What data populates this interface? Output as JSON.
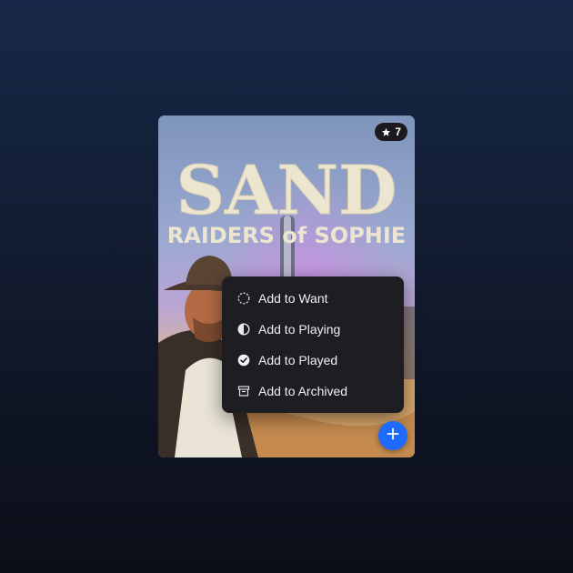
{
  "card": {
    "rating": "7",
    "cover_title": "SAND",
    "cover_subtitle": "RAIDERS of SOPHIE",
    "rating_icon": "star-icon"
  },
  "menu": {
    "items": [
      {
        "label": "Add to Want",
        "icon": "dashed-circle-icon"
      },
      {
        "label": "Add to Playing",
        "icon": "half-circle-icon"
      },
      {
        "label": "Add to Played",
        "icon": "check-circle-icon"
      },
      {
        "label": "Add to Archived",
        "icon": "archive-box-icon"
      }
    ]
  },
  "fab": {
    "icon": "plus-icon"
  },
  "colors": {
    "accent": "#1f6bff",
    "menu_bg": "#1e1e22",
    "badge_bg": "#1b1b1f"
  }
}
